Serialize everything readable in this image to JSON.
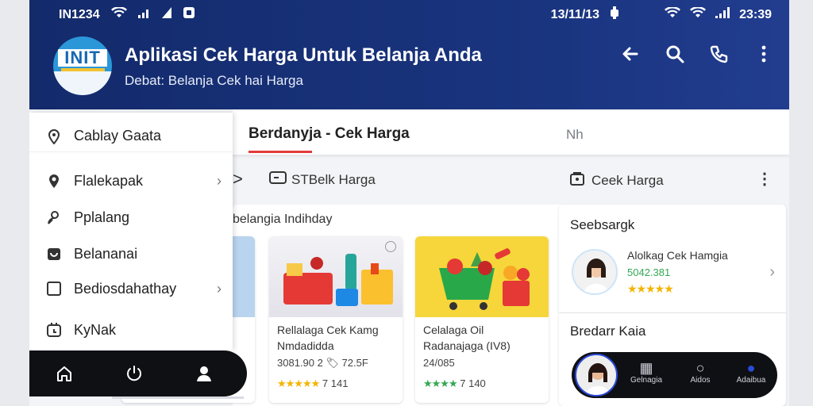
{
  "status_bar": {
    "carrier": "IN1234",
    "date": "13/11/13",
    "time": "23:39"
  },
  "header": {
    "logo_text": "INIT",
    "title": "Aplikasi Cek Harga Untuk Belanja Anda",
    "subtitle": "Debat: Belanja Cek hai Harga",
    "icons": [
      "back-arrow-icon",
      "search-icon",
      "phone-icon",
      "more-vert-icon"
    ]
  },
  "drawer": {
    "items": [
      {
        "label": "Cablay Gaata",
        "icon": "location-pin-icon",
        "chevron": false
      },
      {
        "label": "Flalekapak",
        "icon": "map-pin-icon",
        "chevron": true
      },
      {
        "label": "Pplalang",
        "icon": "person-search-icon",
        "chevron": false
      },
      {
        "label": "Belananai",
        "icon": "bag-icon",
        "chevron": false
      },
      {
        "label": "Bediosdahathay",
        "icon": "square-icon",
        "chevron": true
      },
      {
        "label": "KyNak",
        "icon": "timer-icon",
        "chevron": false
      }
    ]
  },
  "bottom_nav": {
    "icons": [
      "home-icon",
      "power-icon",
      "user-icon"
    ]
  },
  "tabs": {
    "active": "Berdanyja - Cek Harga",
    "other": "Nh"
  },
  "toolbar": {
    "chevron": ">",
    "item_a": "STBelk Harga",
    "item_b": "Ceek Harga",
    "more": "⋮"
  },
  "section": {
    "title": "belangia Indihday",
    "cards": [
      {
        "name": "Rellalaga Cek Kamg",
        "sub": "Nmdadidda",
        "price": "3081.90 2 🏷 72.5F",
        "stars": "★★★★★",
        "rating": "7 141"
      },
      {
        "name": "Celalaga Oil",
        "sub": "Radanajaga (IV8)",
        "price": "24/085",
        "stars": "★★★★",
        "rating": "7 140"
      }
    ]
  },
  "right_panel": {
    "title": "Seebsargk",
    "item_name": "Alolkag Cek Hamgia",
    "item_price": "5042.381",
    "item_stars": "★★★★★",
    "subtitle": "Bredarr Kaia"
  },
  "right_nav": {
    "items": [
      {
        "label": "Gelnagia",
        "icon": "grid-icon"
      },
      {
        "label": "Aidos",
        "icon": "search-icon"
      },
      {
        "label": "Adaibua",
        "icon": "chat-icon"
      }
    ]
  }
}
